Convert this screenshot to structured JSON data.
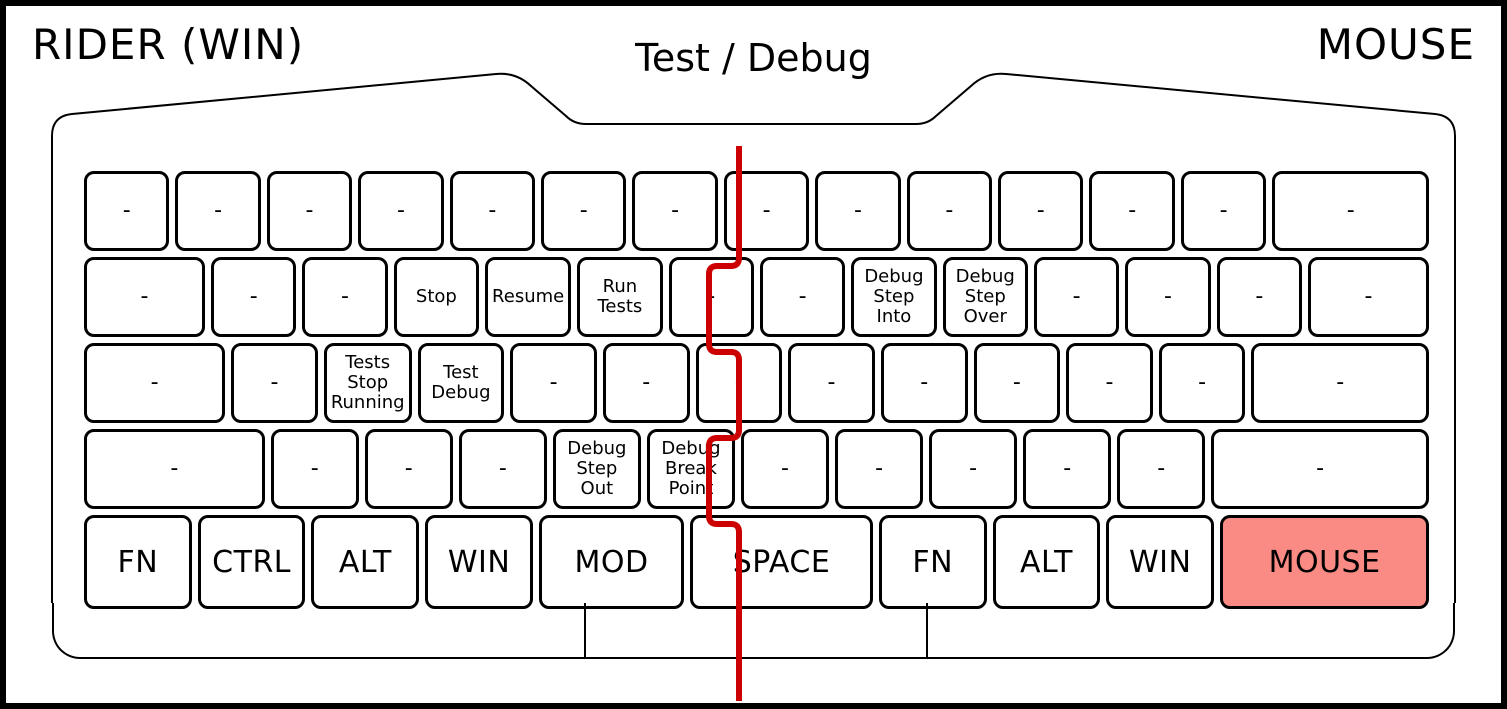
{
  "header": {
    "left": "RIDER (WIN)",
    "center": "Test / Debug",
    "right": "MOUSE"
  },
  "dash": "-",
  "rows": {
    "r1": [
      "-",
      "-",
      "-",
      "-",
      "-",
      "-",
      "-",
      "-",
      "-",
      "-",
      "-",
      "-",
      "-",
      "-"
    ],
    "r2": [
      "-",
      "-",
      "-",
      "Stop",
      "Resume",
      "Run\nTests",
      "-",
      "-",
      "Debug\nStep\nInto",
      "Debug\nStep\nOver",
      "-",
      "-",
      "-",
      "-"
    ],
    "r3": [
      "-",
      "-",
      "Tests\nStop\nRunning",
      "Test\nDebug",
      "-",
      "-",
      "-",
      "-",
      "-",
      "-",
      "-",
      "-",
      "-"
    ],
    "r4": [
      "-",
      "-",
      "-",
      "-",
      "Debug\nStep\nOut",
      "Debug\nBreak\nPoint",
      "-",
      "-",
      "-",
      "-",
      "-",
      "-"
    ],
    "r5": [
      "FN",
      "CTRL",
      "ALT",
      "WIN",
      "MOD",
      "SPACE",
      "FN",
      "ALT",
      "WIN",
      "MOUSE"
    ]
  },
  "highlight_key": "MOUSE",
  "colors": {
    "highlight": "#f98b84",
    "divider": "#cc0000"
  }
}
